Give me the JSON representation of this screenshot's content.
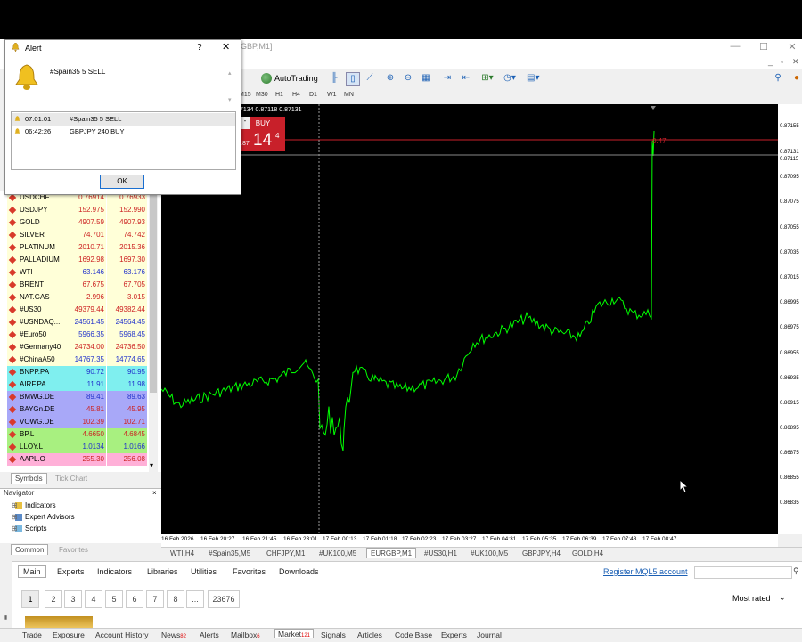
{
  "window": {
    "title": "GBP,M1]"
  },
  "toolbar": {
    "autotrading": "AutoTrading"
  },
  "timeframes": [
    "M15",
    "M30",
    "H1",
    "H4",
    "D1",
    "W1",
    "MN"
  ],
  "chart": {
    "info": "7134 0.87118 0.87131",
    "buy_label": "BUY",
    "price_small": ".87",
    "price_big": "14",
    "price_sup": "4",
    "line_label": "0:47",
    "colors": {
      "line": "#00ff00",
      "bg": "#000000",
      "redline": "#c8202a"
    },
    "price_axis": [
      "0.87155",
      "0.87131",
      "0.87115",
      "0.87095",
      "0.87075",
      "0.87055",
      "0.87035",
      "0.87015",
      "0.86995",
      "0.86975",
      "0.86955",
      "0.86935",
      "0.86915",
      "0.86895",
      "0.86875",
      "0.86855",
      "0.86835"
    ],
    "time_axis": [
      "16 Feb 2026",
      "16 Feb 20:27",
      "16 Feb 21:45",
      "16 Feb 23:01",
      "17 Feb 00:13",
      "17 Feb 01:18",
      "17 Feb 02:23",
      "17 Feb 03:27",
      "17 Feb 04:31",
      "17 Feb 05:35",
      "17 Feb 06:39",
      "17 Feb 07:43",
      "17 Feb 08:47"
    ]
  },
  "chart_tabs": [
    "WTI,H4",
    "#Spain35,M5",
    "CHFJPY,M1",
    "#UK100,M5",
    "EURGBP,M1",
    "#US30,H1",
    "#UK100,M5",
    "GBPJPY,H4",
    "GOLD,H4"
  ],
  "alert": {
    "title": "Alert",
    "message": "#Spain35 5  SELL",
    "rows": [
      {
        "time": "07:01:01",
        "text": "#Spain35 5  SELL"
      },
      {
        "time": "06:42:26",
        "text": "GBPJPY 240  BUY"
      }
    ],
    "ok": "OK"
  },
  "market_watch": [
    {
      "sym": "USDCHF",
      "bid": "0.76914",
      "ask": "0.76933",
      "bg": "#ffffd8",
      "c": "#cc2222"
    },
    {
      "sym": "USDJPY",
      "bid": "152.975",
      "ask": "152.990",
      "bg": "#ffffd8",
      "c": "#cc2222"
    },
    {
      "sym": "GOLD",
      "bid": "4907.59",
      "ask": "4907.93",
      "bg": "#ffffd8",
      "c": "#cc2222"
    },
    {
      "sym": "SILVER",
      "bid": "74.701",
      "ask": "74.742",
      "bg": "#ffffd8",
      "c": "#cc2222"
    },
    {
      "sym": "PLATINUM",
      "bid": "2010.71",
      "ask": "2015.36",
      "bg": "#ffffd8",
      "c": "#cc2222"
    },
    {
      "sym": "PALLADIUM",
      "bid": "1692.98",
      "ask": "1697.30",
      "bg": "#ffffd8",
      "c": "#cc2222"
    },
    {
      "sym": "WTI",
      "bid": "63.146",
      "ask": "63.176",
      "bg": "#ffffd8",
      "c": "#2233cc"
    },
    {
      "sym": "BRENT",
      "bid": "67.675",
      "ask": "67.705",
      "bg": "#ffffd8",
      "c": "#cc2222"
    },
    {
      "sym": "NAT.GAS",
      "bid": "2.996",
      "ask": "3.015",
      "bg": "#ffffd8",
      "c": "#cc2222"
    },
    {
      "sym": "#US30",
      "bid": "49379.44",
      "ask": "49382.44",
      "bg": "#ffffd8",
      "c": "#cc2222"
    },
    {
      "sym": "#USNDAQ...",
      "bid": "24561.45",
      "ask": "24564.45",
      "bg": "#ffffd8",
      "c": "#2233cc"
    },
    {
      "sym": "#Euro50",
      "bid": "5966.35",
      "ask": "5968.45",
      "bg": "#ffffd8",
      "c": "#2233cc"
    },
    {
      "sym": "#Germany40",
      "bid": "24734.00",
      "ask": "24736.50",
      "bg": "#ffffd8",
      "c": "#cc2222"
    },
    {
      "sym": "#ChinaA50",
      "bid": "14767.35",
      "ask": "14774.65",
      "bg": "#ffffd8",
      "c": "#2233cc"
    },
    {
      "sym": "BNPP.PA",
      "bid": "90.72",
      "ask": "90.95",
      "bg": "#7fefef",
      "c": "#2233cc"
    },
    {
      "sym": "AIRF.PA",
      "bid": "11.91",
      "ask": "11.98",
      "bg": "#7fefef",
      "c": "#2233cc"
    },
    {
      "sym": "BMWG.DE",
      "bid": "89.41",
      "ask": "89.63",
      "bg": "#a8a8f8",
      "c": "#2233cc"
    },
    {
      "sym": "BAYGn.DE",
      "bid": "45.81",
      "ask": "45.95",
      "bg": "#a8a8f8",
      "c": "#cc2222"
    },
    {
      "sym": "VOWG.DE",
      "bid": "102.39",
      "ask": "102.71",
      "bg": "#a8a8f8",
      "c": "#cc2222"
    },
    {
      "sym": "BP.L",
      "bid": "4.6650",
      "ask": "4.6845",
      "bg": "#a8f080",
      "c": "#cc2222"
    },
    {
      "sym": "LLOY.L",
      "bid": "1.0134",
      "ask": "1.0166",
      "bg": "#a8f080",
      "c": "#2233cc"
    },
    {
      "sym": "AAPL.O",
      "bid": "255.30",
      "ask": "256.08",
      "bg": "#ffb0d8",
      "c": "#cc2222"
    }
  ],
  "mw_tabs": [
    "Symbols",
    "Tick Chart"
  ],
  "navigator": {
    "header": "Navigator",
    "items": [
      "Indicators",
      "Expert Advisors",
      "Scripts"
    ],
    "tabs": [
      "Common",
      "Favorites"
    ]
  },
  "terminal": {
    "tabs": [
      "Main",
      "Experts",
      "Indicators",
      "Libraries",
      "Utilities",
      "Favorites",
      "Downloads"
    ],
    "register": "Register MQL5 account",
    "pages": [
      "1",
      "2",
      "3",
      "4",
      "5",
      "6",
      "7",
      "8",
      "...",
      "23676"
    ],
    "sort": "Most rated"
  },
  "bottom_tabs": [
    {
      "label": "Trade",
      "badge": ""
    },
    {
      "label": "Exposure",
      "badge": ""
    },
    {
      "label": "Account History",
      "badge": ""
    },
    {
      "label": "News",
      "badge": "82"
    },
    {
      "label": "Alerts",
      "badge": ""
    },
    {
      "label": "Mailbox",
      "badge": "6"
    },
    {
      "label": "Market",
      "badge": "121"
    },
    {
      "label": "Signals",
      "badge": ""
    },
    {
      "label": "Articles",
      "badge": ""
    },
    {
      "label": "Code Base",
      "badge": ""
    },
    {
      "label": "Experts",
      "badge": ""
    },
    {
      "label": "Journal",
      "badge": ""
    }
  ]
}
